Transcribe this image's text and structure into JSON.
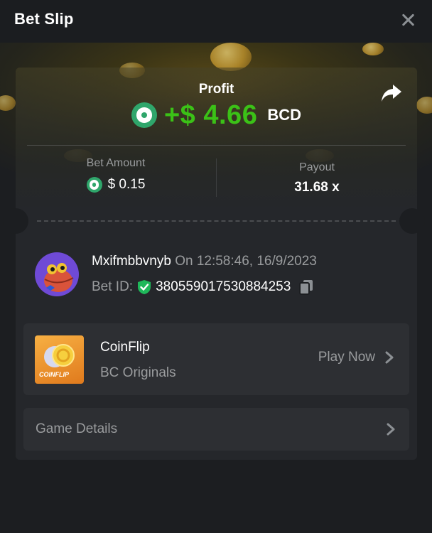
{
  "header": {
    "title": "Bet Slip"
  },
  "profit": {
    "label": "Profit",
    "amount": "+$ 4.66",
    "currency": "BCD"
  },
  "stats": {
    "bet_amount_label": "Bet Amount",
    "bet_amount_value": "$ 0.15",
    "payout_label": "Payout",
    "payout_value": "31.68 x"
  },
  "user": {
    "name": "Mxifmbbvnyb",
    "timestamp": "On 12:58:46, 16/9/2023",
    "bet_id_label": "Bet ID:",
    "bet_id": "380559017530884253"
  },
  "game": {
    "thumb_label": "COINFLIP",
    "name": "CoinFlip",
    "provider": "BC Originals",
    "play_label": "Play Now"
  },
  "details": {
    "label": "Game Details"
  },
  "colors": {
    "profit_green": "#3bc117",
    "bc_green": "#2fa66b",
    "shield_green": "#1fb85a",
    "card_bg": "#25272b",
    "page_bg": "#1c1e21"
  },
  "icons": {
    "close": "close-icon",
    "share": "share-icon",
    "currency": "bc-coin-icon",
    "verified": "shield-check-icon",
    "copy": "copy-icon",
    "chevron": "chevron-right-icon"
  }
}
